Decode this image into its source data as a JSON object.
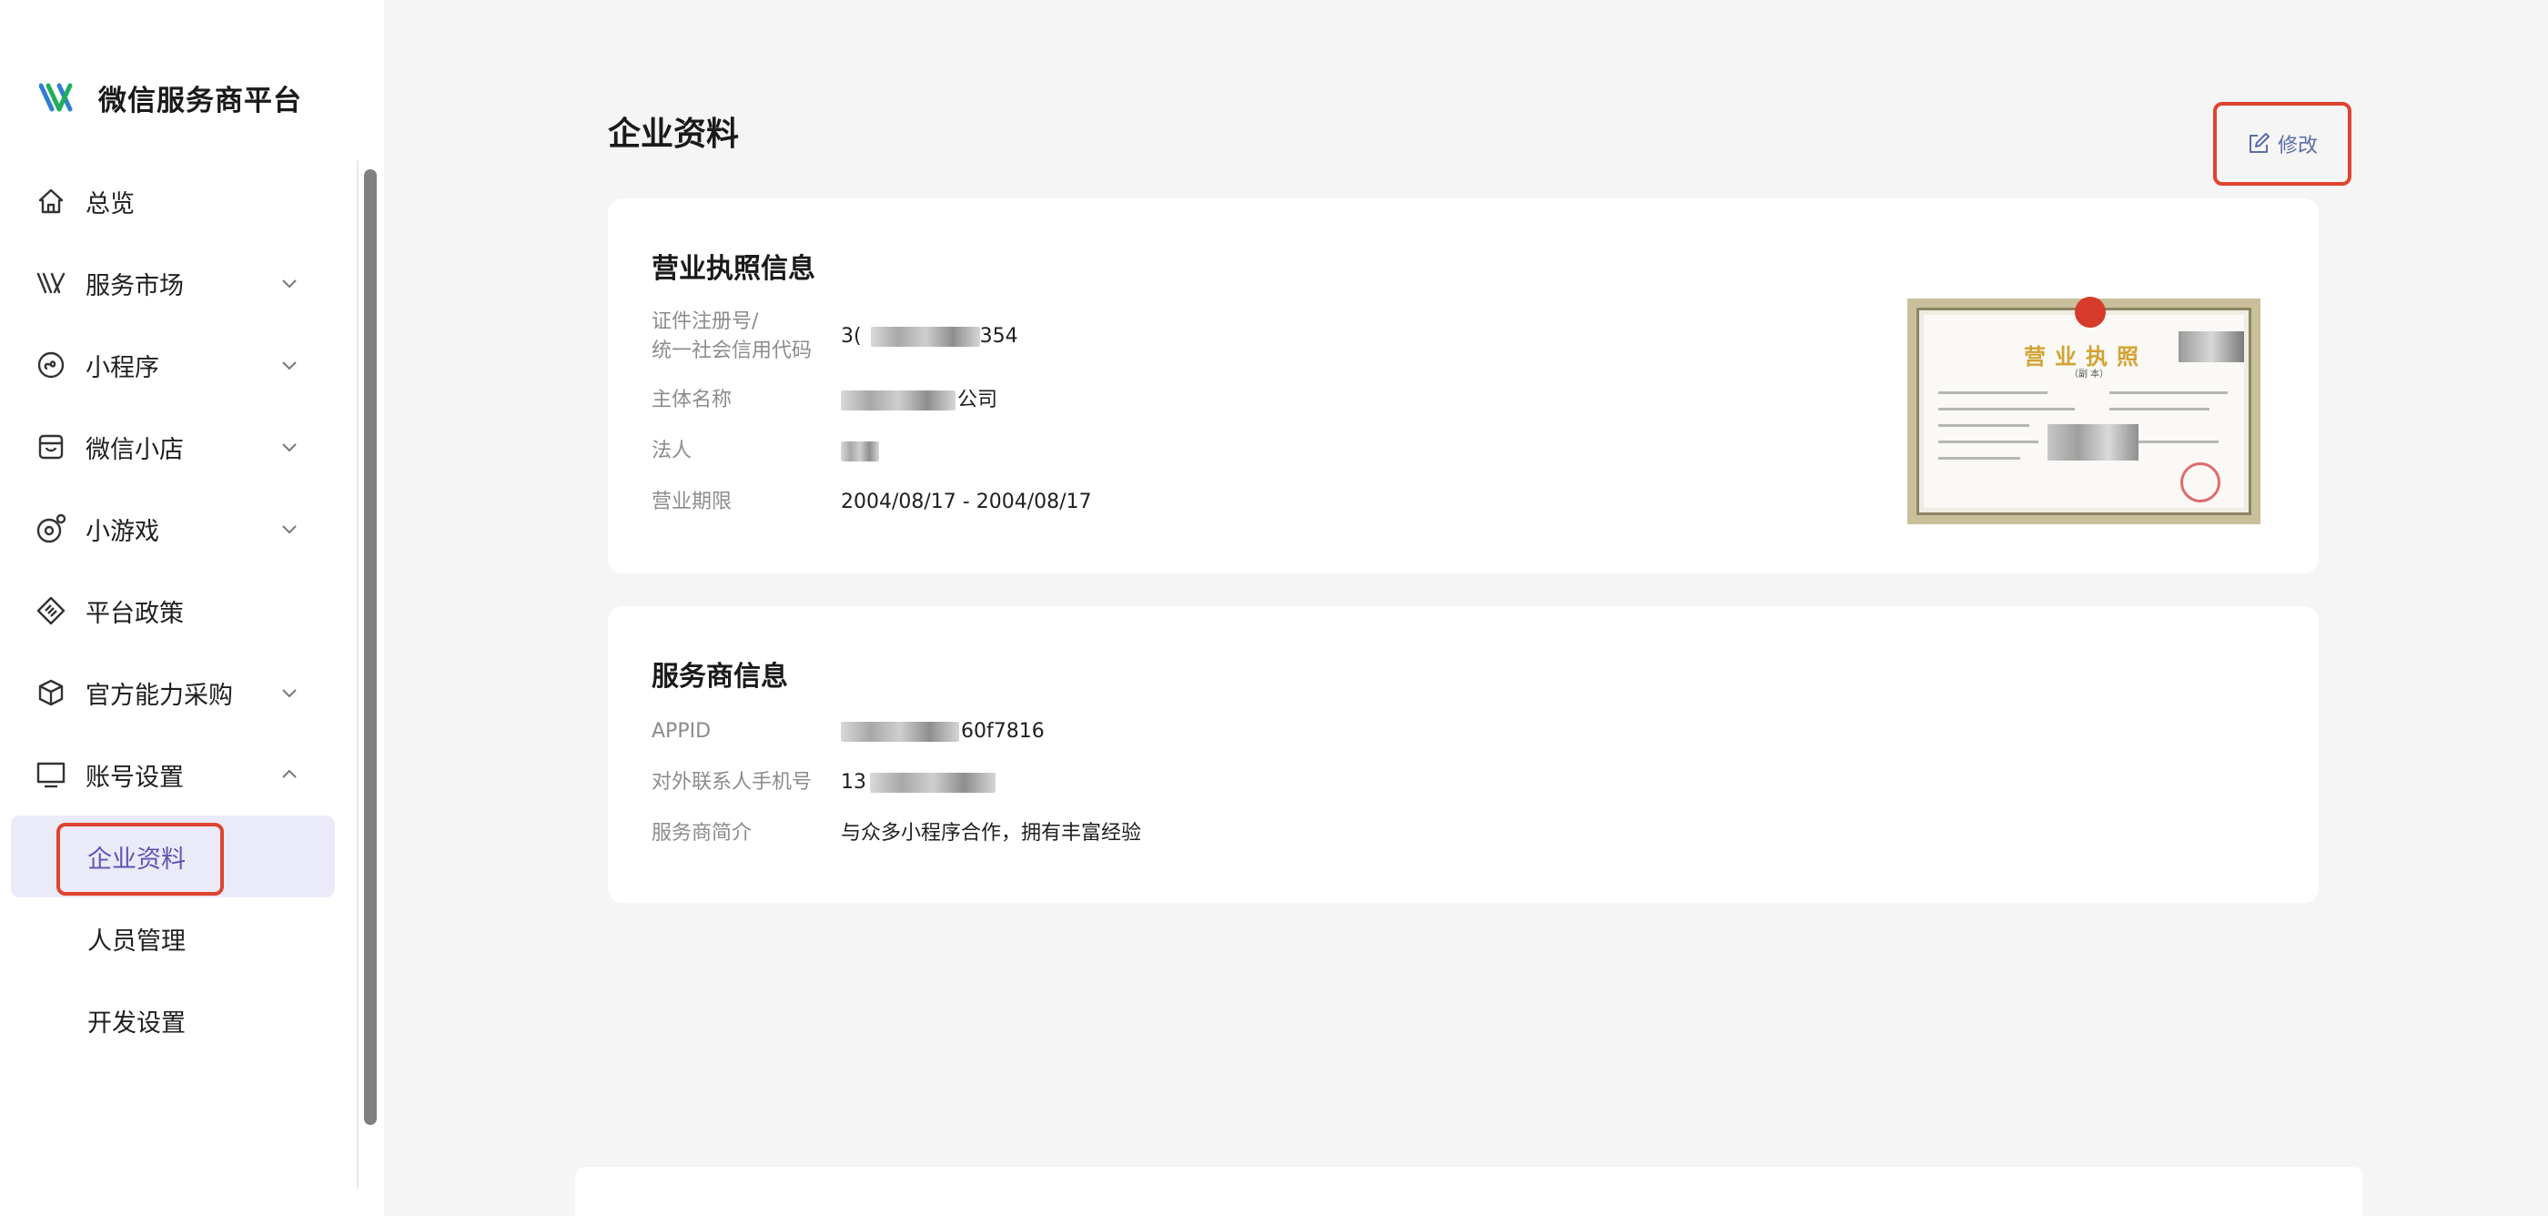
{
  "brand": {
    "title": "微信服务商平台",
    "logo_icon": "wechat-service-logo-icon"
  },
  "sidebar": {
    "items": [
      {
        "label": "总览",
        "icon": "home-icon",
        "expandable": false
      },
      {
        "label": "服务市场",
        "icon": "market-icon",
        "expandable": true,
        "expanded": false
      },
      {
        "label": "小程序",
        "icon": "mini-program-icon",
        "expandable": true,
        "expanded": false
      },
      {
        "label": "微信小店",
        "icon": "shop-icon",
        "expandable": true,
        "expanded": false
      },
      {
        "label": "小游戏",
        "icon": "game-icon",
        "expandable": true,
        "expanded": false
      },
      {
        "label": "平台政策",
        "icon": "policy-icon",
        "expandable": false
      },
      {
        "label": "官方能力采购",
        "icon": "box-icon",
        "expandable": true,
        "expanded": false
      },
      {
        "label": "账号设置",
        "icon": "monitor-icon",
        "expandable": true,
        "expanded": true
      }
    ],
    "sub_items": [
      {
        "label": "企业资料",
        "active": true
      },
      {
        "label": "人员管理",
        "active": false
      },
      {
        "label": "开发设置",
        "active": false
      }
    ]
  },
  "page": {
    "title": "企业资料",
    "edit_label": "修改"
  },
  "license_card": {
    "title": "营业执照信息",
    "fields": [
      {
        "label_line1": "证件注册号/",
        "label_line2": "统一社会信用代码",
        "value_prefix": "3(",
        "value_suffix": "354"
      },
      {
        "label": "主体名称",
        "value_suffix": "公司"
      },
      {
        "label": "法人"
      },
      {
        "label": "营业期限",
        "value": "2004/08/17 - 2004/08/17"
      }
    ],
    "image": {
      "title": "营业执照",
      "subtitle": "（副 本）"
    }
  },
  "provider_card": {
    "title": "服务商信息",
    "fields": [
      {
        "label": "APPID",
        "value_suffix": "60f7816"
      },
      {
        "label": "对外联系人手机号",
        "value_prefix": "13"
      },
      {
        "label": "服务商简介",
        "value": "与众多小程序合作，拥有丰富经验"
      }
    ]
  },
  "colors": {
    "accent": "#5a56b3",
    "highlight": "#e0432f",
    "edit": "#5b6ea8"
  }
}
